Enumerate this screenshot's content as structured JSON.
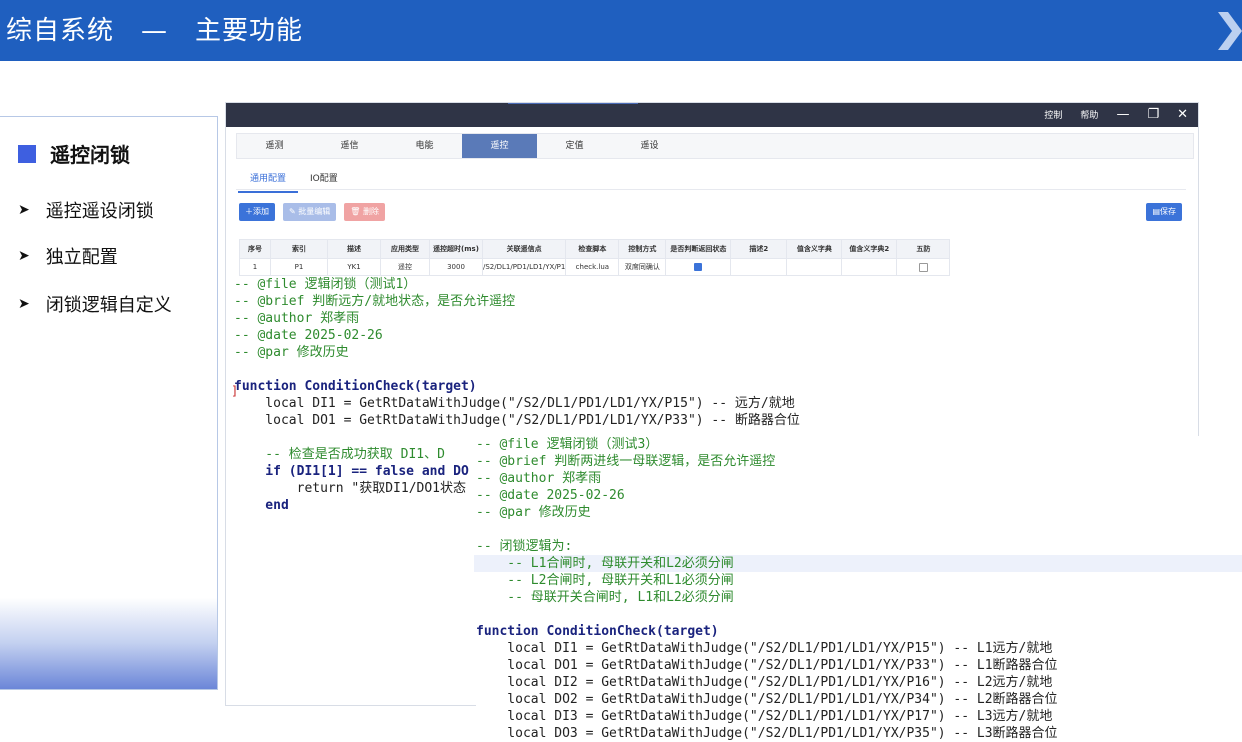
{
  "header": {
    "title": "综自系统　—　主要功能"
  },
  "left_nav": {
    "active": "遥控闭锁",
    "items": [
      {
        "label": "遥控遥设闭锁"
      },
      {
        "label": "独立配置"
      },
      {
        "label": "闭锁逻辑自定义"
      }
    ]
  },
  "app": {
    "window_buttons": [
      "控制",
      "帮助",
      "—",
      "❐",
      "✕"
    ],
    "tabs": [
      "遥测",
      "遥信",
      "电能",
      "遥控",
      "定值",
      "遥设"
    ],
    "active_tab": "遥控",
    "subtabs": [
      "通用配置",
      "IO配置"
    ],
    "active_subtab": "通用配置",
    "buttons": {
      "add": "＋添加",
      "batch_edit": "✎ 批量编辑",
      "delete": "🗑 删除",
      "save": "▤保存"
    },
    "table": {
      "headers": [
        "序号",
        "索引",
        "描述",
        "应用类型",
        "遥控超时(ms)",
        "关联遥信点",
        "检查脚本",
        "控制方式",
        "是否判断返回状态",
        "描述2",
        "值含义字典",
        "值含义字典2",
        "五防"
      ],
      "rows": [
        {
          "no": "1",
          "index": "P1",
          "desc": "YK1",
          "app_type": "遥控",
          "timeout": "3000",
          "point": "/S2/DL1/PD1/LD1/YX/P1",
          "script": "check.lua",
          "mode": "双席同确认",
          "check_return": true,
          "desc2": "",
          "dict": "",
          "dict2": "",
          "wufang": false
        }
      ]
    }
  },
  "code1": {
    "lines": [
      "-- @file 逻辑闭锁（测试1）",
      "-- @brief 判断远方/就地状态，是否允许遥控",
      "-- @author 郑孝雨",
      "-- @date 2025-02-26",
      "-- @par 修改历史",
      "",
      "function ConditionCheck(target)",
      "    local DI1 = GetRtDataWithJudge(\"/S2/DL1/PD1/LD1/YX/P15\") -- 远方/就地",
      "    local DO1 = GetRtDataWithJudge(\"/S2/DL1/PD1/LD1/YX/P33\") -- 断路器合位",
      "",
      "    -- 检查是否成功获取 DI1、D",
      "    if (DI1[1] == false and DO",
      "        return \"获取DI1/DO1状态",
      "    end"
    ]
  },
  "code2": {
    "lines": [
      "-- @file 逻辑闭锁（测试3）",
      "-- @brief 判断两进线一母联逻辑，是否允许遥控",
      "-- @author 郑孝雨",
      "-- @date 2025-02-26",
      "-- @par 修改历史",
      "",
      "-- 闭锁逻辑为:",
      "    -- L1合闸时, 母联开关和L2必须分闸",
      "    -- L2合闸时, 母联开关和L1必须分闸",
      "    -- 母联开关合闸时, L1和L2必须分闸",
      "",
      "function ConditionCheck(target)",
      "    local DI1 = GetRtDataWithJudge(\"/S2/DL1/PD1/LD1/YX/P15\") -- L1远方/就地",
      "    local DO1 = GetRtDataWithJudge(\"/S2/DL1/PD1/LD1/YX/P33\") -- L1断路器合位",
      "    local DI2 = GetRtDataWithJudge(\"/S2/DL1/PD1/LD1/YX/P16\") -- L2远方/就地",
      "    local DO2 = GetRtDataWithJudge(\"/S2/DL1/PD1/LD1/YX/P34\") -- L2断路器合位",
      "    local DI3 = GetRtDataWithJudge(\"/S2/DL1/PD1/LD1/YX/P17\") -- L3远方/就地",
      "    local DO3 = GetRtDataWithJudge(\"/S2/DL1/PD1/LD1/YX/P35\") -- L3断路器合位"
    ]
  }
}
